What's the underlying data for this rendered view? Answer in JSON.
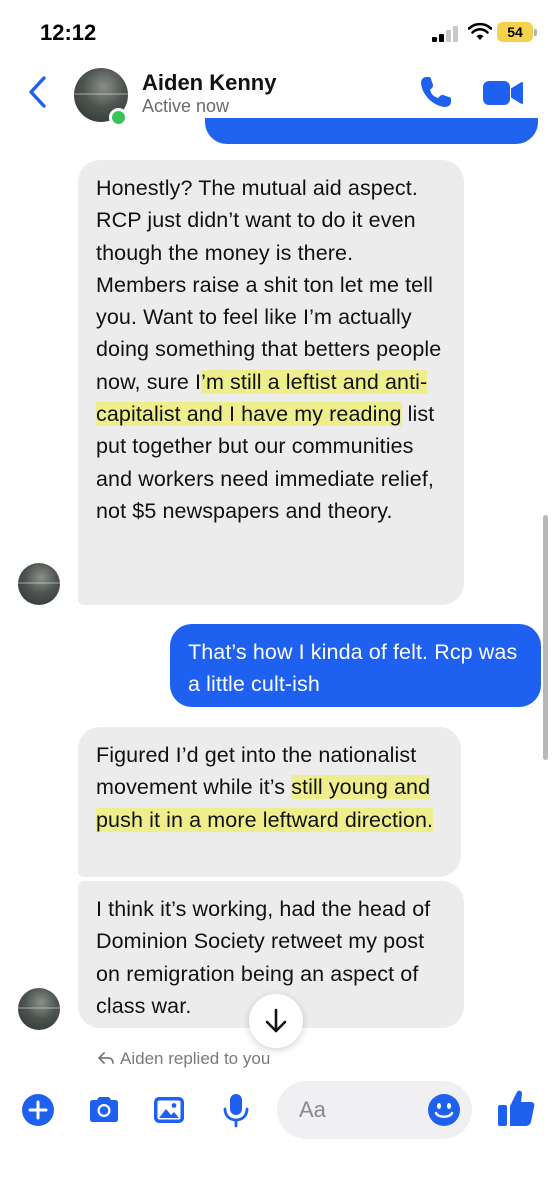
{
  "status_bar": {
    "time": "12:12",
    "battery": "54"
  },
  "header": {
    "contact_name": "Aiden Kenny",
    "contact_status": "Active now"
  },
  "messages": [
    {
      "direction": "incoming",
      "segments": [
        {
          "text": "Honestly? The mutual aid aspect. RCP just didn’t want to do it even though the money is there. Members raise a shit ton let me tell you. Want to feel like I’m actually doing something that betters people now, sure I",
          "highlight": false
        },
        {
          "text": "’m still a leftist and anti-capitalist and I have my reading",
          "highlight": true
        },
        {
          "text": " list put together but our communities and workers need immediate relief, not $5 newspapers and theory.",
          "highlight": false
        }
      ]
    },
    {
      "direction": "outgoing",
      "text": "That’s how I kinda of felt. Rcp was a little cult-ish"
    },
    {
      "direction": "incoming",
      "segments": [
        {
          "text": "Figured I’d get into the nationalist movement while it’s ",
          "highlight": false
        },
        {
          "text": "still young and push it in a more leftward direction.",
          "highlight": true
        }
      ]
    },
    {
      "direction": "incoming",
      "text": "I think it’s working, had the head of Dominion Society retweet my post on remigration being an aspect of class war."
    }
  ],
  "reply_note": "Aiden replied to you",
  "composer": {
    "placeholder": "Aa"
  },
  "colors": {
    "accent": "#1e60ef",
    "incoming_bubble": "#ececed",
    "highlight": "#f0f03c",
    "online": "#36c45a",
    "battery": "#f4d24c"
  },
  "icons": [
    "back-chevron-icon",
    "phone-icon",
    "video-camera-icon",
    "plus-icon",
    "camera-icon",
    "image-icon",
    "microphone-icon",
    "emoji-icon",
    "thumbs-up-icon",
    "arrow-down-icon",
    "reply-icon",
    "wifi-icon",
    "signal-icon",
    "battery-icon"
  ]
}
